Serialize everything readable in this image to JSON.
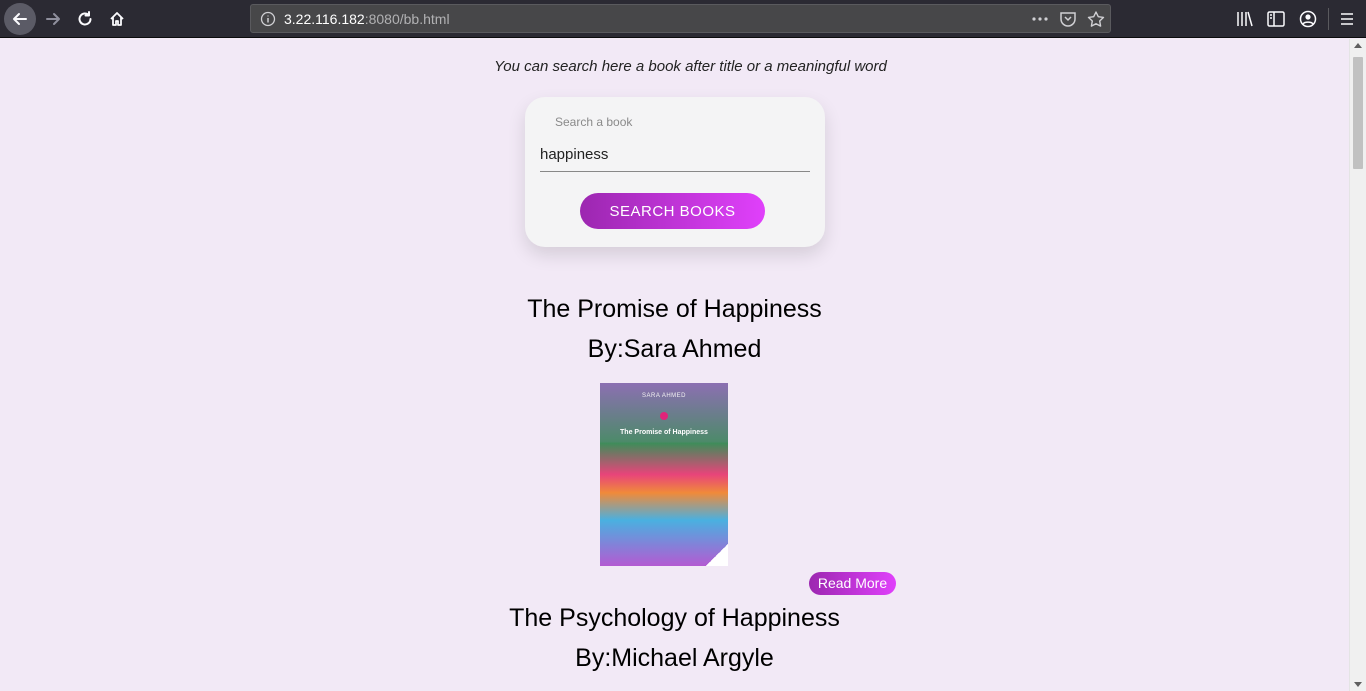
{
  "browser": {
    "url_host": "3.22.116.182",
    "url_rest": ":8080/bb.html"
  },
  "page": {
    "intro_text": "You can search here a book after title or a meaningful word",
    "search": {
      "label": "Search a book",
      "value": "happiness",
      "button_label": "SEARCH BOOKS"
    },
    "books": [
      {
        "title": "The Promise of Happiness",
        "author_line": "By:Sara Ahmed",
        "cover_author": "SARA AHMED",
        "cover_title": "The Promise of Happiness",
        "read_more_label": "Read More"
      },
      {
        "title": "The Psychology of Happiness",
        "author_line": "By:Michael Argyle"
      }
    ]
  },
  "colors": {
    "page_background": "#f2e9f6",
    "accent_start": "#9c27b0",
    "accent_end": "#e040fb"
  }
}
